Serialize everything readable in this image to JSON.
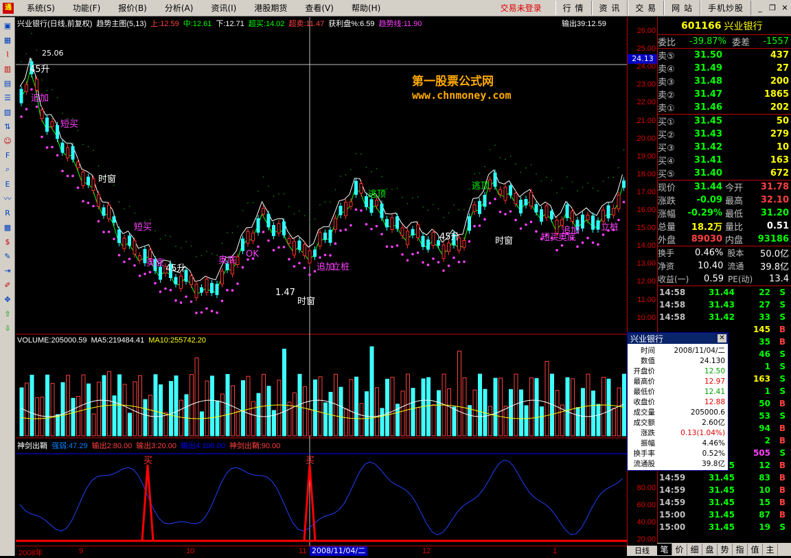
{
  "menubar": {
    "items": [
      "系统(S)",
      "功能(F)",
      "报价(B)",
      "分析(A)",
      "资讯(I)",
      "港股期货",
      "查看(V)",
      "帮助(H)"
    ],
    "status": "交易未登录",
    "right_buttons": [
      "行 情",
      "资 讯",
      "交 易",
      "网 站",
      "手机炒股"
    ]
  },
  "toolbar": {
    "icons": [
      "window-icon",
      "grid-icon",
      "line-chart-icon",
      "bar-chart-icon",
      "table-icon",
      "list-icon",
      "report-icon",
      "sort-icon",
      "people-icon",
      "f10-icon",
      "search-icon",
      "etf-icon",
      "wave-icon",
      "rsi-icon",
      "multi-icon",
      "dollar-icon",
      "wrench-icon",
      "export-icon",
      "pen-icon",
      "move-icon",
      "up-arrow-icon",
      "down-arrow-icon"
    ]
  },
  "main_chart": {
    "title": "兴业银行(日线,前复权)",
    "indicator": "趋势主图(5,13)",
    "values": [
      {
        "label": "上:12.59",
        "color": "#ff4040"
      },
      {
        "label": "中:12.61",
        "color": "#00ff00"
      },
      {
        "label": "下:12.71",
        "color": "#ffffff"
      },
      {
        "label": "超买:14.02",
        "color": "#00ff00"
      },
      {
        "label": "超卖:11.47",
        "color": "#ff4040"
      },
      {
        "label": "获利盘%:6.59",
        "color": "#ffffff"
      },
      {
        "label": "趋势线:11.90",
        "color": "#ff40ff"
      }
    ],
    "output": "输出39:12.59",
    "watermark_title": "第一股票公式网",
    "watermark_url": "www.chnmoney.com",
    "high_label": "25.06",
    "cursor_price": "24.13",
    "annotations": [
      {
        "text": "45升",
        "color": "#ffffff"
      },
      {
        "text": "追加",
        "color": "#ff40ff"
      },
      {
        "text": "短买",
        "color": "#ff40ff"
      },
      {
        "text": "时窗",
        "color": "#ffffff"
      },
      {
        "text": "短买",
        "color": "#ff40ff"
      },
      {
        "text": "奥底",
        "color": "#ff40ff"
      },
      {
        "text": "奥底",
        "color": "#ff40ff"
      },
      {
        "text": "OK",
        "color": "#ff40ff"
      },
      {
        "text": "追加",
        "color": "#ff40ff"
      },
      {
        "text": "立桩",
        "color": "#ff40ff"
      },
      {
        "text": "1.47",
        "color": "#ffffff"
      },
      {
        "text": "时窗",
        "color": "#ffffff"
      },
      {
        "text": "逃顶",
        "color": "#00ff00"
      },
      {
        "text": "45升",
        "color": "#ffffff"
      },
      {
        "text": "逃顶",
        "color": "#00ff00"
      },
      {
        "text": "时窗",
        "color": "#ffffff"
      },
      {
        "text": "追加",
        "color": "#ff40ff"
      },
      {
        "text": "短买",
        "color": "#ff40ff"
      },
      {
        "text": "奥底",
        "color": "#ff40ff"
      },
      {
        "text": "立桩",
        "color": "#ff40ff"
      },
      {
        "text": "45升",
        "color": "#ffffff"
      }
    ]
  },
  "volume_panel": {
    "label": "VOLUME:205000.59",
    "ma5": "MA5:219484.41",
    "ma10": "MA10:255742.20"
  },
  "sword_panel": {
    "label": "神剑出鞘",
    "values": [
      {
        "label": "强弱:47.29",
        "color": "#0080ff"
      },
      {
        "label": "输出2:80.00",
        "color": "#ff4040"
      },
      {
        "label": "输出3:20.00",
        "color": "#ff4040"
      },
      {
        "label": "输出4:100.00",
        "color": "#0000ff"
      },
      {
        "label": "神剑出鞘:90.00",
        "color": "#ff4040"
      }
    ],
    "buy_marks": [
      "买",
      "买"
    ],
    "axis_ticks": [
      "80.00",
      "60.00",
      "40.00",
      "20.00"
    ]
  },
  "price_axis": [
    "26.00",
    "25.00",
    "24.00",
    "23.00",
    "22.00",
    "21.00",
    "20.00",
    "19.00",
    "18.00",
    "17.00",
    "16.00",
    "15.00",
    "14.00",
    "13.00",
    "12.00",
    "11.00",
    "10.00"
  ],
  "time_axis": [
    "2008年",
    "9",
    "10",
    "11",
    "12",
    "1"
  ],
  "time_axis_cursor": "2008/11/04/二",
  "day_tab": "日线",
  "quote": {
    "code": "601166",
    "name": "兴业银行",
    "weibi_label": "委比",
    "weibi": "-39.87%",
    "weicha_label": "委差",
    "weicha": "-1557",
    "asks": [
      {
        "label": "卖⑤",
        "price": "31.50",
        "vol": "437"
      },
      {
        "label": "卖④",
        "price": "31.49",
        "vol": "27"
      },
      {
        "label": "卖③",
        "price": "31.48",
        "vol": "200"
      },
      {
        "label": "卖②",
        "price": "31.47",
        "vol": "1865"
      },
      {
        "label": "卖①",
        "price": "31.46",
        "vol": "202"
      }
    ],
    "bids": [
      {
        "label": "买①",
        "price": "31.45",
        "vol": "50"
      },
      {
        "label": "买②",
        "price": "31.43",
        "vol": "279"
      },
      {
        "label": "买③",
        "price": "31.42",
        "vol": "10"
      },
      {
        "label": "买④",
        "price": "31.41",
        "vol": "163"
      },
      {
        "label": "买⑤",
        "price": "31.40",
        "vol": "672"
      }
    ],
    "stats": [
      {
        "l1": "现价",
        "v1": "31.44",
        "c1": "#00ff00",
        "l2": "今开",
        "v2": "31.78",
        "c2": "#ff4040"
      },
      {
        "l1": "涨跌",
        "v1": "-0.09",
        "c1": "#00ff00",
        "l2": "最高",
        "v2": "32.10",
        "c2": "#ff4040"
      },
      {
        "l1": "涨幅",
        "v1": "-0.29%",
        "c1": "#00ff00",
        "l2": "最低",
        "v2": "31.20",
        "c2": "#00ff00"
      },
      {
        "l1": "总量",
        "v1": "18.2万",
        "c1": "#ffff00",
        "l2": "量比",
        "v2": "0.51",
        "c2": "#ffffff"
      },
      {
        "l1": "外盘",
        "v1": "89030",
        "c1": "#ff4040",
        "l2": "内盘",
        "v2": "93186",
        "c2": "#00ff00"
      }
    ],
    "stats2": [
      {
        "l1": "换手",
        "v1": "0.46%",
        "l2": "股本",
        "v2": "50.0亿"
      },
      {
        "l1": "净资",
        "v1": "10.40",
        "l2": "流通",
        "v2": "39.8亿"
      },
      {
        "l1": "收益(一)",
        "v1": "0.59",
        "l2": "PE(动)",
        "v2": "13.4"
      }
    ],
    "ticks": [
      {
        "t": "14:58",
        "p": "31.44",
        "q": "22",
        "d": "S"
      },
      {
        "t": "14:58",
        "p": "31.43",
        "q": "27",
        "d": "S"
      },
      {
        "t": "14:58",
        "p": "31.42",
        "q": "33",
        "d": "S"
      },
      {
        "t": "",
        "p": "",
        "q": "145",
        "d": "B"
      },
      {
        "t": "",
        "p": "",
        "q": "35",
        "d": "B"
      },
      {
        "t": "",
        "p": "",
        "q": "46",
        "d": "S"
      },
      {
        "t": "",
        "p": "",
        "q": "1",
        "d": "S"
      },
      {
        "t": "",
        "p": "",
        "q": "163",
        "d": "S"
      },
      {
        "t": "",
        "p": "",
        "q": "1",
        "d": "S"
      },
      {
        "t": "",
        "p": "",
        "q": "50",
        "d": "B"
      },
      {
        "t": "",
        "p": "",
        "q": "53",
        "d": "S"
      },
      {
        "t": "",
        "p": "",
        "q": "94",
        "d": "B"
      },
      {
        "t": "",
        "p": "",
        "q": "2",
        "d": "B"
      },
      {
        "t": "",
        "p": "",
        "q": "505",
        "d": "S"
      },
      {
        "t": "14:59",
        "p": "31.45",
        "q": "12",
        "d": "B"
      },
      {
        "t": "14:59",
        "p": "31.45",
        "q": "83",
        "d": "B"
      },
      {
        "t": "14:59",
        "p": "31.45",
        "q": "10",
        "d": "B"
      },
      {
        "t": "14:59",
        "p": "31.45",
        "q": "15",
        "d": "B"
      },
      {
        "t": "15:00",
        "p": "31.45",
        "q": "87",
        "d": "B"
      },
      {
        "t": "15:00",
        "p": "31.45",
        "q": "19",
        "d": "S"
      }
    ],
    "tabs": [
      "笔",
      "价",
      "细",
      "盘",
      "势",
      "指",
      "值",
      "主"
    ]
  },
  "popup": {
    "title": "兴业银行",
    "rows": [
      {
        "k": "时间",
        "v": "2008/11/04/二",
        "c": "#000000"
      },
      {
        "k": "数值",
        "v": "24.130",
        "c": "#000000"
      },
      {
        "k": "开盘价",
        "v": "12.50",
        "c": "#00a000"
      },
      {
        "k": "最高价",
        "v": "12.97",
        "c": "#e00000"
      },
      {
        "k": "最低价",
        "v": "12.41",
        "c": "#00a000"
      },
      {
        "k": "收盘价",
        "v": "12.88",
        "c": "#e00000"
      },
      {
        "k": "成交量",
        "v": "205000.6",
        "c": "#000000"
      },
      {
        "k": "成交额",
        "v": "2.60亿",
        "c": "#000000"
      },
      {
        "k": "涨跌",
        "v": "0.13(1.04%)",
        "c": "#e00000"
      },
      {
        "k": "振幅",
        "v": "4.46%",
        "c": "#000000"
      },
      {
        "k": "换手率",
        "v": "0.52%",
        "c": "#000000"
      },
      {
        "k": "流通股",
        "v": "39.8亿",
        "c": "#000000"
      }
    ]
  }
}
